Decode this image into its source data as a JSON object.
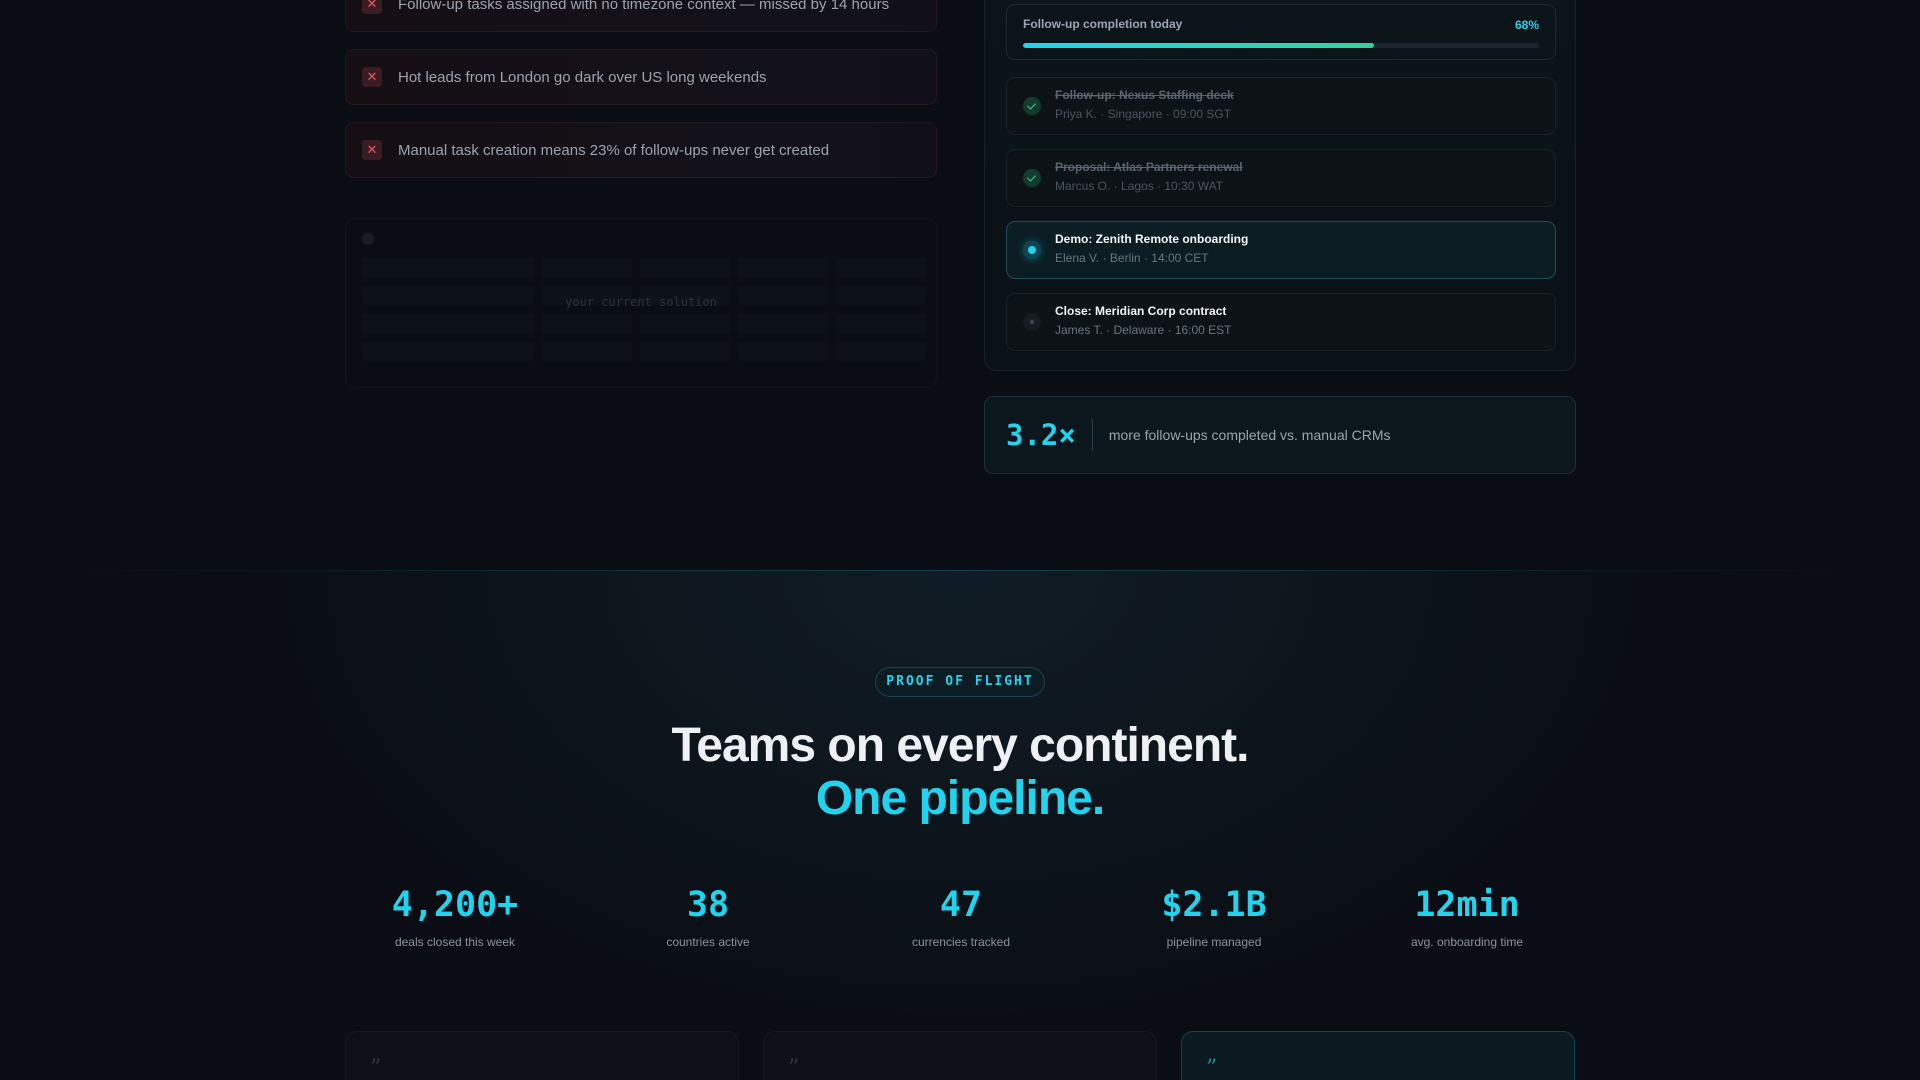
{
  "problems": [
    "Follow-up tasks assigned with no timezone context — missed by 14 hours",
    "Hot leads from London go dark over US long weekends",
    "Manual task creation means 23% of follow-ups never get created"
  ],
  "problem_icon": "x-mark-icon",
  "ghost_table": {
    "label": "your current solution"
  },
  "followup": {
    "progress_label": "Follow-up completion today",
    "progress_value": 68,
    "progress_text": "68%",
    "tasks": [
      {
        "title": "Follow-up: Nexus Staffing deck",
        "meta": "Priya K. · Singapore · 09:00 SGT",
        "status": "done"
      },
      {
        "title": "Proposal: Atlas Partners renewal",
        "meta": "Marcus O. · Lagos · 10:30 WAT",
        "status": "done"
      },
      {
        "title": "Demo: Zenith Remote onboarding",
        "meta": "Elena V. · Berlin · 14:00 CET",
        "status": "current"
      },
      {
        "title": "Close: Meridian Corp contract",
        "meta": "James T. · Delaware · 16:00 EST",
        "status": "pending"
      }
    ]
  },
  "stat": {
    "value": "3.2×",
    "text": "more follow-ups completed vs. manual CRMs"
  },
  "proof": {
    "pill": "PROOF OF FLIGHT",
    "headline_line1": "Teams on every continent.",
    "headline_line2": "One pipeline.",
    "metrics": [
      {
        "value": "4,200+",
        "label": "deals closed this week"
      },
      {
        "value": "38",
        "label": "countries active"
      },
      {
        "value": "47",
        "label": "currencies tracked"
      },
      {
        "value": "$2.1B",
        "label": "pipeline managed"
      },
      {
        "value": "12min",
        "label": "avg. onboarding time"
      }
    ]
  },
  "quotes": [
    {
      "mark": "”"
    },
    {
      "mark": "”"
    },
    {
      "mark": "”"
    }
  ],
  "colors": {
    "background": "#0a0e14",
    "accent": "#22d3ee",
    "success": "#34d399",
    "danger": "#e35b63"
  }
}
